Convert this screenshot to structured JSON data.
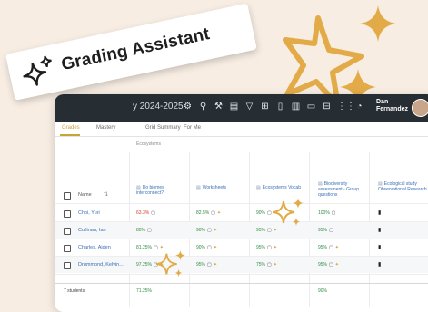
{
  "banner": {
    "title": "Grading Assistant"
  },
  "topbar": {
    "year": "y 2024-2025",
    "user_name": "Dan Fernandez"
  },
  "tabs": [
    {
      "label": "Grades",
      "active": true
    },
    {
      "label": "Mastery",
      "active": false
    },
    {
      "label": "Grid Summary",
      "active": false
    },
    {
      "label": "For Me",
      "active": false
    }
  ],
  "table": {
    "group_label": "Ecosystems",
    "name_header": "Name",
    "columns": [
      "Do biomes interconnect?",
      "Worksheets",
      "Ecosystems Vocab",
      "Biodiversity assessment - Group questions",
      "Ecological study Observational Research"
    ],
    "rows": [
      {
        "name": "Choi, Yuri",
        "cells": [
          "63.3%",
          "82.5%",
          "90%",
          "100%"
        ]
      },
      {
        "name": "Cullinan, Ian",
        "cells": [
          "80%",
          "90%",
          "95%",
          "95%"
        ]
      },
      {
        "name": "Charles, Aiden",
        "cells": [
          "81.25%",
          "90%",
          "95%",
          "95%"
        ]
      },
      {
        "name": "Drummond, Kelvin...",
        "cells": [
          "97.25%",
          "95%",
          "75%",
          "95%"
        ]
      }
    ],
    "footer_count": "7 students",
    "footer_pct_1": "71.25%",
    "footer_pct_2": "90%"
  },
  "colors": {
    "background": "#f7ede3",
    "accent_gold": "#e3ab47",
    "topbar": "#262d33",
    "link_blue": "#3b6fb5"
  }
}
